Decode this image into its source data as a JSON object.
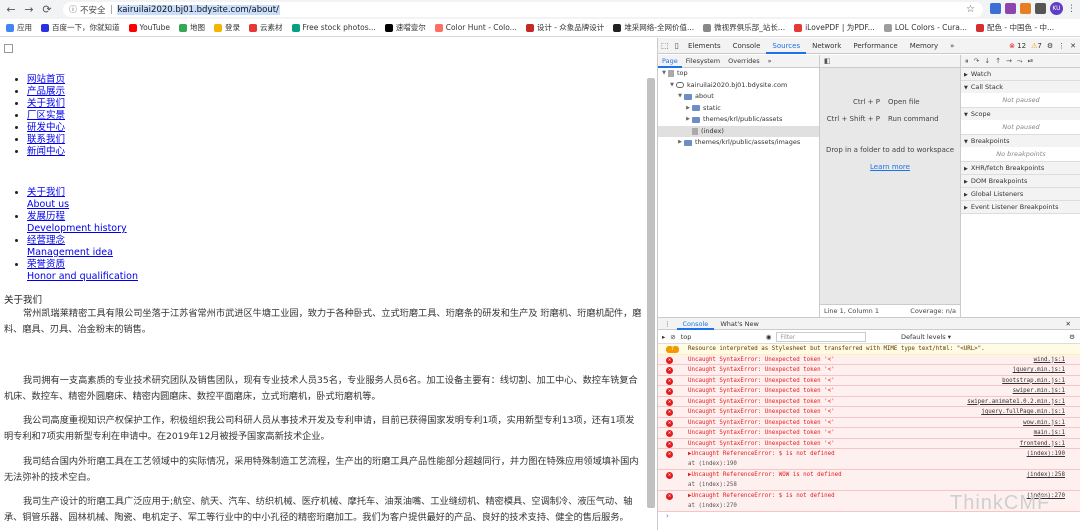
{
  "browser": {
    "back": "←",
    "forward": "→",
    "reload": "⟳",
    "security_label": "不安全",
    "url": "kairuilai2020.bj01.bdysite.com/about/",
    "avatar": "KU"
  },
  "bookmarks": [
    {
      "label": "应用",
      "color": "#4285f4"
    },
    {
      "label": "百度一下，你就知道",
      "color": "#2932e1"
    },
    {
      "label": "YouTube",
      "color": "#ff0000"
    },
    {
      "label": "地图",
      "color": "#34a853"
    },
    {
      "label": "登录",
      "color": "#f4b400"
    },
    {
      "label": "云素材",
      "color": "#e53935"
    },
    {
      "label": "Free stock photos...",
      "color": "#05a081"
    },
    {
      "label": "速噹壹尔",
      "color": "#000000"
    },
    {
      "label": "Color Hunt - Colo...",
      "color": "#ff6f61"
    },
    {
      "label": "设计 - 众象品牌设计",
      "color": "#c62828"
    },
    {
      "label": "堆采网络-全网价值...",
      "color": "#222222"
    },
    {
      "label": "微视界俱乐部_站长...",
      "color": "#888888"
    },
    {
      "label": "iLovePDF | 为PDF...",
      "color": "#e53935"
    },
    {
      "label": "LOL Colors - Cura...",
      "color": "#9e9e9e"
    },
    {
      "label": "配色 - 中国色 - 中...",
      "color": "#d32f2f"
    }
  ],
  "page": {
    "nav1": [
      "网站首页",
      "产品展示",
      "关于我们",
      "厂区实景",
      "研发中心",
      "联系我们",
      "新闻中心"
    ],
    "nav2": [
      {
        "cn": "关于我们",
        "en": "About us"
      },
      {
        "cn": "发展历程",
        "en": "Development history"
      },
      {
        "cn": "经营理念",
        "en": "Management idea"
      },
      {
        "cn": "荣誉资质",
        "en": "Honor and qualification"
      }
    ],
    "section_label": "关于我们",
    "paragraphs": [
      "常州凯瑞莱精密工具有限公司坐落于江苏省常州市武进区牛塘工业园，致力于各种卧式、立式珩磨工具、珩磨条的研发和生产及 珩磨机、珩磨机配件，磨料、磨具、刃具、冶金粉末的销售。",
      "我司拥有一支高素质的专业技术研究团队及销售团队，现有专业技术人员35名，专业服务人员6名。加工设备主要有：线切割、加工中心、数控车铣复合机床、数控车、精密外圆磨床、精密内圆磨床、数控平面磨床，立式珩磨机，卧式珩磨机等。",
      "我公司高度重视知识产权保护工作，积极组织我公司科研人员从事技术开发及专利申请，目前已获得国家发明专利1项，实用新型专利13项，还有1项发明专利和7项实用新型专利在申请中。在2019年12月被授予国家高新技术企业。",
      "我司结合国内外珩磨工具在工艺领域中的实际情况，采用特殊制造工艺流程，生产出的珩磨工具产品性能部分超越同行，并力图在特殊应用领域填补国内无法弥补的技术空白。",
      "我司生产设计的珩磨工具广泛应用于;航空、航天、汽车、纺织机械、医疗机械、摩托车、油泵油嘴、工业缝纫机、精密模具、空调制冷、液压气动、轴承、铜管乐器、园林机械、陶瓷、电机定子、军工等行业中的中小孔径的精密珩磨加工。我们为客户提供最好的产品、良好的技术支持、健全的售后服务。"
    ]
  },
  "devtools": {
    "tabs": [
      "Elements",
      "Console",
      "Sources",
      "Network",
      "Performance",
      "Memory"
    ],
    "active_tab": "Sources",
    "more": "»",
    "error_count": "12",
    "warn_count": "7",
    "nav_tabs": [
      "Page",
      "Filesystem",
      "Overrides"
    ],
    "tree": [
      {
        "label": "top",
        "depth": 0,
        "type": "frame",
        "arrow": "▼"
      },
      {
        "label": "kairuilai2020.bj01.bdysite.com",
        "depth": 1,
        "type": "cloud",
        "arrow": "▼"
      },
      {
        "label": "about",
        "depth": 2,
        "type": "folder",
        "arrow": "▼"
      },
      {
        "label": "static",
        "depth": 3,
        "type": "folder",
        "arrow": "▶"
      },
      {
        "label": "themes/krl/public/assets",
        "depth": 3,
        "type": "folder",
        "arrow": "▶"
      },
      {
        "label": "(index)",
        "depth": 3,
        "type": "file",
        "arrow": ""
      },
      {
        "label": "themes/krl/public/assets/images",
        "depth": 2,
        "type": "folder",
        "arrow": "▶"
      }
    ],
    "editor": {
      "shortcuts": [
        {
          "keys": "Ctrl + P",
          "action": "Open file"
        },
        {
          "keys": "Ctrl + Shift + P",
          "action": "Run command"
        }
      ],
      "drop": "Drop in a folder to add to workspace",
      "learn_more": "Learn more",
      "status_left": "Line 1, Column 1",
      "status_right": "Coverage: n/a"
    },
    "debugger": {
      "sections": [
        {
          "label": "Watch",
          "body": ""
        },
        {
          "label": "Call Stack",
          "body": "Not paused"
        },
        {
          "label": "Scope",
          "body": "Not paused"
        },
        {
          "label": "Breakpoints",
          "body": "No breakpoints"
        },
        {
          "label": "XHR/fetch Breakpoints",
          "body": ""
        },
        {
          "label": "DOM Breakpoints",
          "body": ""
        },
        {
          "label": "Global Listeners",
          "body": ""
        },
        {
          "label": "Event Listener Breakpoints",
          "body": ""
        }
      ]
    },
    "console": {
      "tabs": [
        "Console",
        "What's New"
      ],
      "context": "top",
      "filter_placeholder": "Filter",
      "levels": "Default levels ▾",
      "messages": [
        {
          "level": "warn",
          "count": "7",
          "text": "Resource interpreted as Stylesheet but transferred with MIME type text/html: \"<URL>\".",
          "src": ""
        },
        {
          "level": "error",
          "text": "Uncaught SyntaxError: Unexpected token '<'",
          "src": "wind.js:1"
        },
        {
          "level": "error",
          "text": "Uncaught SyntaxError: Unexpected token '<'",
          "src": "jquery.min.js:1"
        },
        {
          "level": "error",
          "text": "Uncaught SyntaxError: Unexpected token '<'",
          "src": "bootstrap.min.js:1"
        },
        {
          "level": "error",
          "text": "Uncaught SyntaxError: Unexpected token '<'",
          "src": "swiper.min.js:1"
        },
        {
          "level": "error",
          "text": "Uncaught SyntaxError: Unexpected token '<'",
          "src": "swiper.animate1.0.2.min.js:1"
        },
        {
          "level": "error",
          "text": "Uncaught SyntaxError: Unexpected token '<'",
          "src": "jquery.fullPage.min.js:1"
        },
        {
          "level": "error",
          "text": "Uncaught SyntaxError: Unexpected token '<'",
          "src": "wow.min.js:1"
        },
        {
          "level": "error",
          "text": "Uncaught SyntaxError: Unexpected token '<'",
          "src": "main.js:1"
        },
        {
          "level": "error",
          "text": "Uncaught SyntaxError: Unexpected token '<'",
          "src": "frontend.js:1"
        },
        {
          "level": "error",
          "text": "▶Uncaught ReferenceError: $ is not defined",
          "src": "(index):190",
          "at": "at (index):190"
        },
        {
          "level": "error",
          "text": "▶Uncaught ReferenceError: WOW is not defined",
          "src": "(index):258",
          "at": "at (index):258"
        },
        {
          "level": "error",
          "text": "▶Uncaught ReferenceError: $ is not defined",
          "src": "(index):270",
          "at": "at (index):270"
        }
      ],
      "prompt": "›"
    }
  },
  "watermark": "ThinkCMF"
}
